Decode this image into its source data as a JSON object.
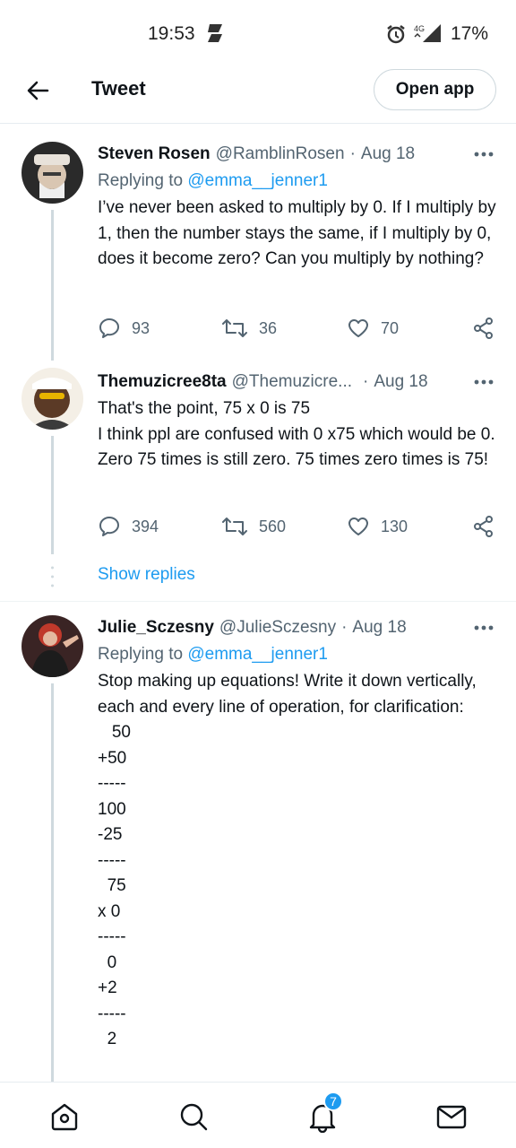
{
  "status_bar": {
    "time": "19:53",
    "network": "4G",
    "battery": "17%"
  },
  "header": {
    "title": "Tweet",
    "open_app_label": "Open app"
  },
  "tweets": [
    {
      "author": "Steven Rosen",
      "handle": "@RamblinRosen",
      "date": "Aug 18",
      "replying_prefix": "Replying to",
      "replying_to": "@emma__jenner1",
      "body": "I’ve never been asked to multiply by 0. If I multiply by 1, then the number stays the same, if I multiply by 0, does it become zero? Can you multiply by nothing?",
      "replies": "93",
      "retweets": "36",
      "likes": "70"
    },
    {
      "author": "Themuzicree8ta",
      "handle": "@Themuzicre...",
      "date": "Aug 18",
      "body": "That's the point, 75 x 0 is 75\nI think ppl are confused with 0 x75 which would be 0. Zero 75 times is still zero. 75 times zero times is 75!",
      "replies": "394",
      "retweets": "560",
      "likes": "130"
    },
    {
      "author": "Julie_Sczesny",
      "handle": "@JulieSczesny",
      "date": "Aug 18",
      "replying_prefix": "Replying to",
      "replying_to": "@emma__jenner1",
      "body": "Stop making up equations! Write it down vertically, each and every line of operation, for clarification:\n   50\n+50\n-----\n100\n-25\n-----\n  75\nx 0\n-----\n  0\n+2\n-----\n  2"
    }
  ],
  "show_replies_label": "Show replies",
  "bottom_nav": {
    "notifications_badge": "7"
  },
  "colors": {
    "accent": "#1d9bf0",
    "secondary_text": "#536471",
    "primary_text": "#0f1419"
  }
}
